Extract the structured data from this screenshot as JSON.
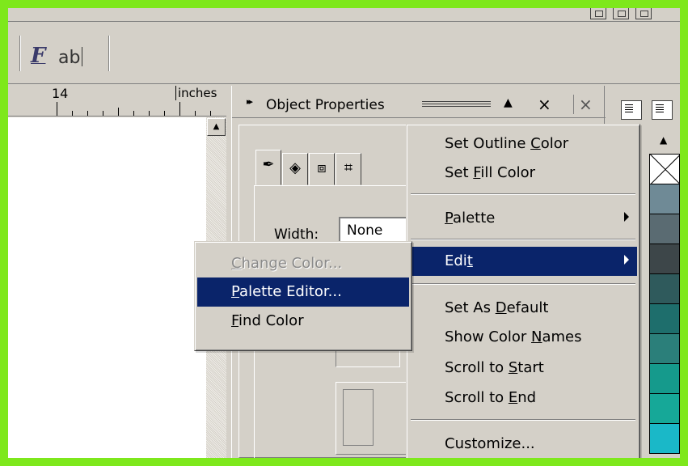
{
  "ruler": {
    "mark": "14",
    "unit": "inches"
  },
  "toolbar": {
    "tool_f_icon": "F",
    "tool_ab_icon": "ab"
  },
  "docker": {
    "title": "Object Properties",
    "width_label": "Width:",
    "width_value": "None"
  },
  "context_menu": {
    "items": [
      {
        "pre": "Set Outline ",
        "u": "C",
        "post": "olor"
      },
      {
        "pre": "Set ",
        "u": "F",
        "post": "ill Color"
      },
      {
        "pre": "",
        "u": "P",
        "post": "alette",
        "submenu": true
      },
      {
        "pre": "Edi",
        "u": "t",
        "post": "",
        "submenu": true,
        "highlighted": true
      },
      {
        "pre": "Set As ",
        "u": "D",
        "post": "efault"
      },
      {
        "pre": "Show Color ",
        "u": "N",
        "post": "ames"
      },
      {
        "pre": "Scroll to ",
        "u": "S",
        "post": "tart"
      },
      {
        "pre": "Scroll to ",
        "u": "E",
        "post": "nd"
      },
      {
        "pre": "Customize...",
        "u": "",
        "post": ""
      }
    ]
  },
  "submenu": {
    "items": [
      {
        "pre": "",
        "u": "C",
        "post": "hange Color...",
        "disabled": true
      },
      {
        "pre": "",
        "u": "P",
        "post": "alette Editor...",
        "highlighted": true
      },
      {
        "pre": "",
        "u": "F",
        "post": "ind Color"
      }
    ]
  },
  "palette": {
    "swatches": [
      "#6f8a96",
      "#5a6b72",
      "#3d4649",
      "#2f5a5c",
      "#1e6e6c",
      "#2b7f7a",
      "#159a8c",
      "#16a898",
      "#1ab8c8"
    ]
  },
  "colors": {
    "highlight": "#0a246a",
    "face": "#d4d0c8",
    "border_accent": "#7ee81c"
  }
}
